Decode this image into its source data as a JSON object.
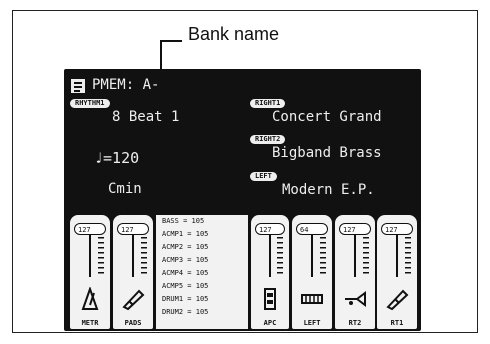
{
  "annotation": {
    "callout": "Bank name"
  },
  "header": {
    "title": "PMEM: A-"
  },
  "rhythm": {
    "tag": "RHYTHM1",
    "value": "8 Beat 1"
  },
  "tempo": {
    "value": "♩=120"
  },
  "chord": {
    "value": "Cmin"
  },
  "right1": {
    "tag": "RIGHT1",
    "value": "Concert Grand"
  },
  "right2": {
    "tag": "RIGHT2",
    "value": "Bigband Brass"
  },
  "left": {
    "tag": "LEFT",
    "value": "Modern E.P."
  },
  "levels": {
    "rows": [
      {
        "name": "BASS",
        "eq": "=",
        "val": "105"
      },
      {
        "name": "ACMP1",
        "eq": "=",
        "val": "105"
      },
      {
        "name": "ACMP2",
        "eq": "=",
        "val": "105"
      },
      {
        "name": "ACMP3",
        "eq": "=",
        "val": "105"
      },
      {
        "name": "ACMP4",
        "eq": "=",
        "val": "105"
      },
      {
        "name": "ACMP5",
        "eq": "=",
        "val": "105"
      },
      {
        "name": "DRUM1",
        "eq": "=",
        "val": "105"
      },
      {
        "name": "DRUM2",
        "eq": "=",
        "val": "105"
      }
    ]
  },
  "tiles": [
    {
      "knob": "127",
      "label": "METR"
    },
    {
      "knob": "127",
      "label": "PADS"
    },
    {
      "knob": "127",
      "label": "APC"
    },
    {
      "knob": "64",
      "label": "LEFT"
    },
    {
      "knob": "127",
      "label": "RT2"
    },
    {
      "knob": "127",
      "label": "RT1"
    }
  ]
}
